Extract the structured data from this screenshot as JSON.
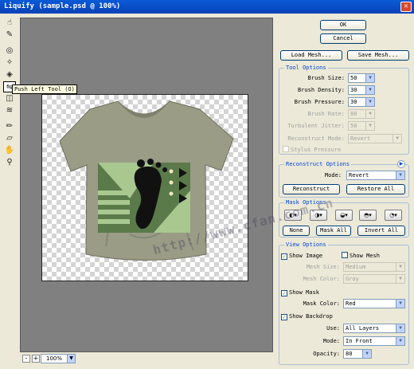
{
  "window": {
    "title": "Liquify (sample.psd @ 100%)"
  },
  "tooltip": "Push Left Tool (O)",
  "statusbar": {
    "zoom": "100%",
    "zoom_out": "-",
    "zoom_in": "+"
  },
  "buttons": {
    "ok": "OK",
    "cancel": "Cancel",
    "load_mesh": "Load Mesh...",
    "save_mesh": "Save Mesh..."
  },
  "tool_options": {
    "title": "Tool Options",
    "brush_size": {
      "label": "Brush Size:",
      "value": "50"
    },
    "brush_density": {
      "label": "Brush Density:",
      "value": "30"
    },
    "brush_pressure": {
      "label": "Brush Pressure:",
      "value": "30"
    },
    "brush_rate": {
      "label": "Brush Rate:",
      "value": "80"
    },
    "turbulent_jitter": {
      "label": "Turbulent Jitter:",
      "value": "50"
    },
    "reconstruct_mode": {
      "label": "Reconstruct Mode:",
      "value": "Revert"
    },
    "stylus_pressure": "Stylus Pressure"
  },
  "reconstruct_options": {
    "title": "Reconstruct Options",
    "mode_label": "Mode:",
    "mode_value": "Revert",
    "reconstruct": "Reconstruct",
    "restore_all": "Restore All"
  },
  "mask_options": {
    "title": "Mask Options",
    "none": "None",
    "mask_all": "Mask All",
    "invert_all": "Invert All"
  },
  "view_options": {
    "title": "View Options",
    "show_image": "Show Image",
    "show_mesh": "Show Mesh",
    "mesh_size": {
      "label": "Mesh Size:",
      "value": "Medium"
    },
    "mesh_color": {
      "label": "Mesh Color:",
      "value": "Gray"
    },
    "show_mask": "Show Mask",
    "mask_color": {
      "label": "Mask Color:",
      "value": "Red"
    },
    "show_backdrop": "Show Backdrop",
    "use": {
      "label": "Use:",
      "value": "All Layers"
    },
    "mode": {
      "label": "Mode:",
      "value": "In Front"
    },
    "opacity": {
      "label": "Opacity:",
      "value": "80"
    }
  },
  "watermark": "http://www.cfan.com.cn",
  "colors": {
    "shirt": "#9a9c86",
    "print_bg": "#5a7a4a",
    "print_light": "#a8c890",
    "accent": "#0046d5"
  },
  "icons": [
    "forward-warp-icon",
    "reconstruct-icon",
    "twirl-clockwise-icon",
    "pucker-icon",
    "bloat-icon",
    "push-left-icon",
    "mirror-icon",
    "turbulence-icon",
    "freeze-mask-icon",
    "thaw-mask-icon",
    "hand-icon",
    "zoom-icon"
  ]
}
